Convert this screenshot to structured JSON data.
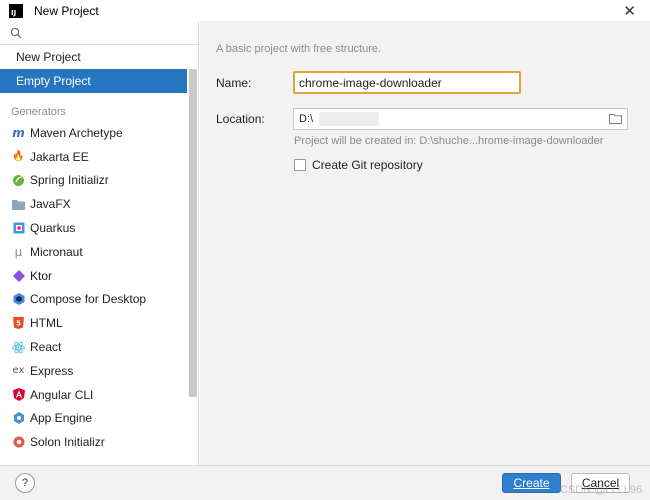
{
  "window": {
    "title": "New Project",
    "logo_text": "IJ"
  },
  "sidebar": {
    "search_placeholder": "",
    "top_items": [
      {
        "label": "New Project"
      },
      {
        "label": "Empty Project"
      }
    ],
    "generators_label": "Generators",
    "generators": [
      {
        "label": "Maven Archetype",
        "icon": "maven-icon"
      },
      {
        "label": "Jakarta EE",
        "icon": "jakarta-icon"
      },
      {
        "label": "Spring Initializr",
        "icon": "spring-icon"
      },
      {
        "label": "JavaFX",
        "icon": "javafx-icon"
      },
      {
        "label": "Quarkus",
        "icon": "quarkus-icon"
      },
      {
        "label": "Micronaut",
        "icon": "micronaut-icon"
      },
      {
        "label": "Ktor",
        "icon": "ktor-icon"
      },
      {
        "label": "Compose for Desktop",
        "icon": "compose-icon"
      },
      {
        "label": "HTML",
        "icon": "html-icon"
      },
      {
        "label": "React",
        "icon": "react-icon"
      },
      {
        "label": "Express",
        "icon": "express-icon"
      },
      {
        "label": "Angular CLI",
        "icon": "angular-icon"
      },
      {
        "label": "App Engine",
        "icon": "app-engine-icon"
      },
      {
        "label": "Solon Initializr",
        "icon": "solon-icon"
      }
    ]
  },
  "main": {
    "description": "A basic project with free structure.",
    "name_label": "Name:",
    "name_value": "chrome-image-downloader",
    "location_label": "Location:",
    "location_value": "D:\\",
    "location_hint": "Project will be created in: D:\\shuche...hrome-image-downloader",
    "git_label": "Create Git repository"
  },
  "footer": {
    "help_label": "?",
    "create_label": "Create",
    "cancel_label": "Cancel",
    "watermark": "CSDN @LLLL96"
  },
  "colors": {
    "selected": "#2675bf",
    "focus_border": "#e0a335",
    "primary_button": "#2f7fd0"
  }
}
